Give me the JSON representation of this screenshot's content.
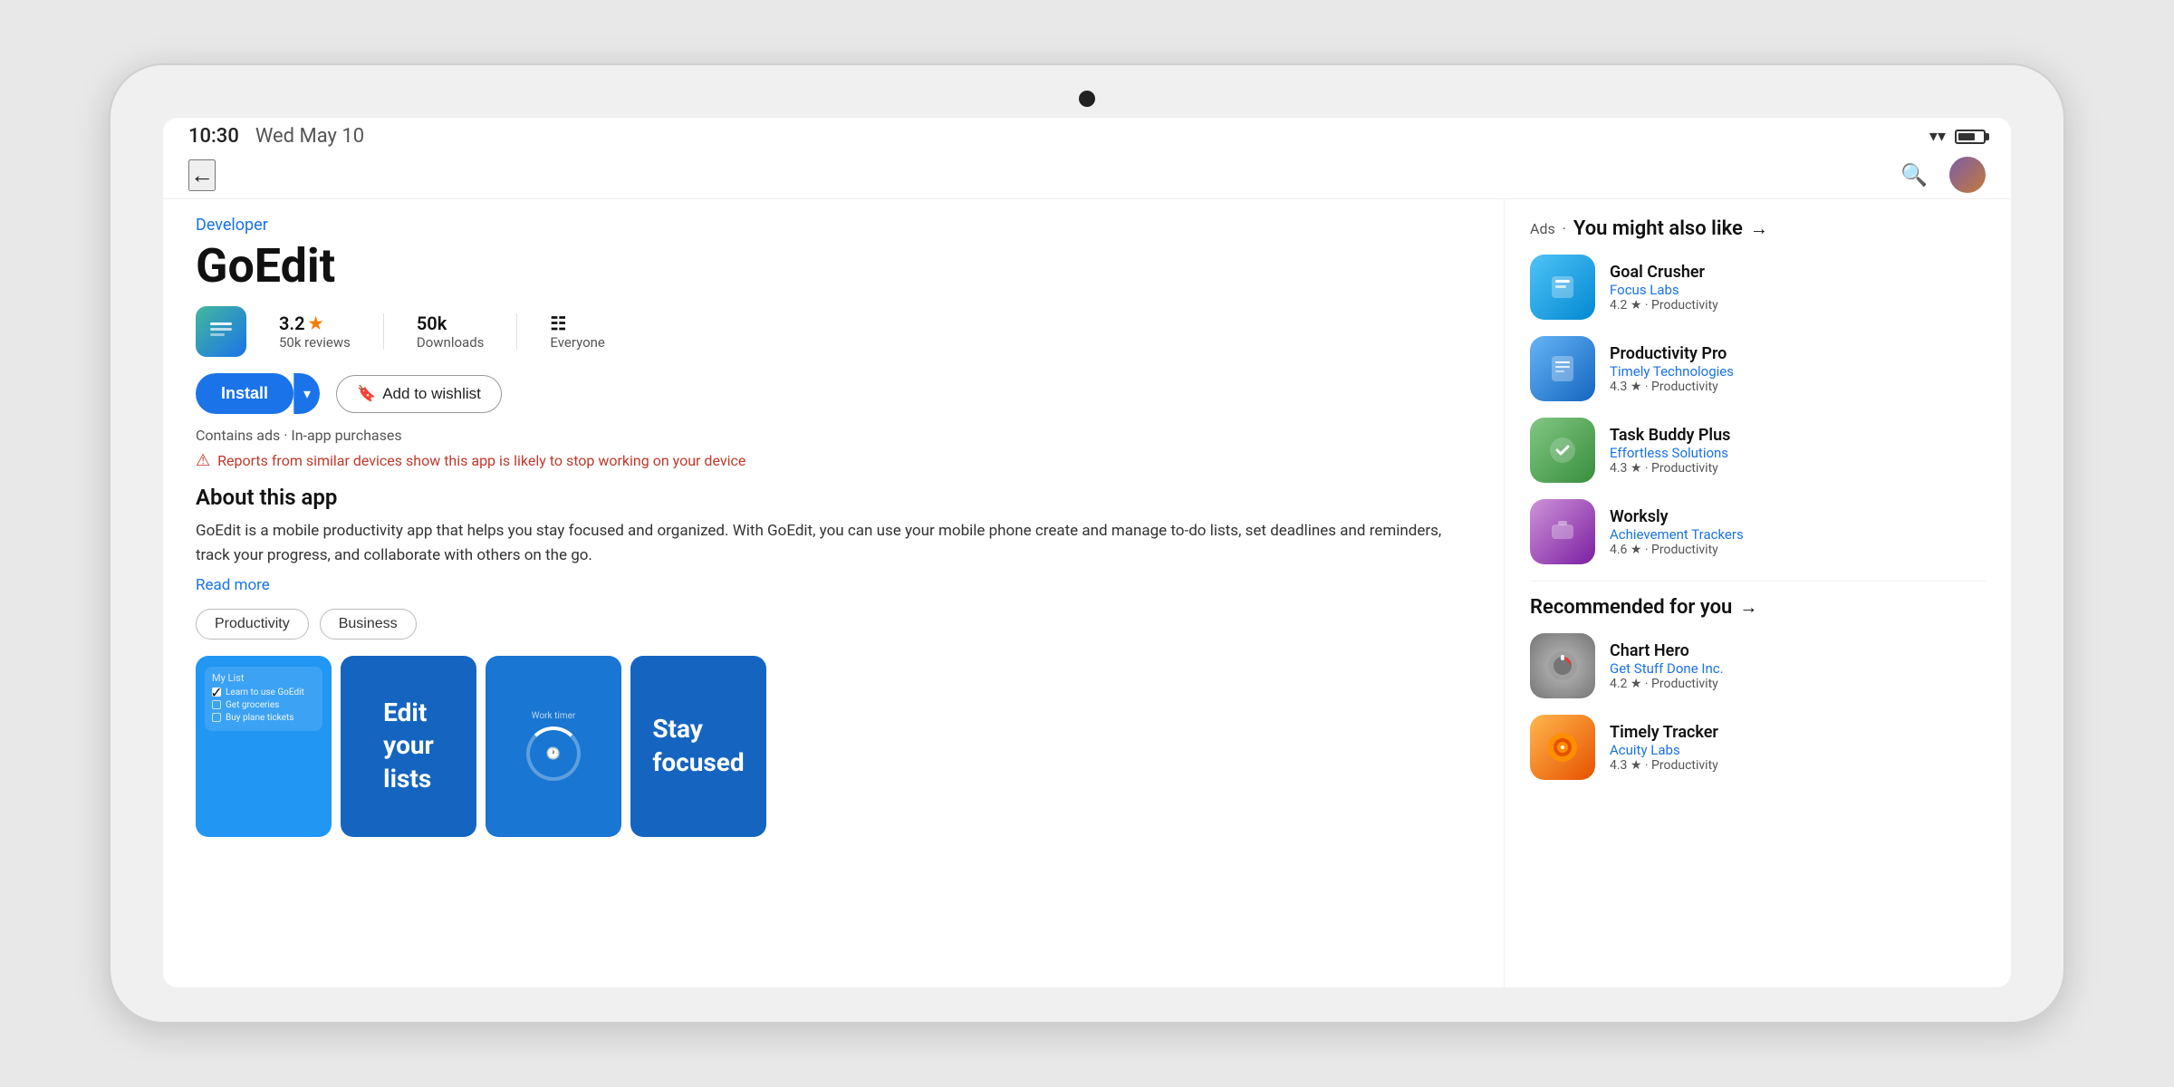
{
  "device": {
    "time": "10:30",
    "date": "Wed May 10"
  },
  "app": {
    "developer": "Developer",
    "title": "GoEdit",
    "rating": "3.2",
    "rating_star": "★",
    "reviews": "50k reviews",
    "downloads": "50k",
    "downloads_label": "Downloads",
    "audience": "Everyone",
    "install_label": "Install",
    "wishlist_label": "Add to wishlist",
    "ads_label": "Contains ads · In-app purchases",
    "warning": "Reports from similar devices show this app is likely to stop working on your device",
    "about_title": "About this app",
    "about_text": "GoEdit is a mobile productivity app that helps you stay focused and organized. With GoEdit, you can use your mobile phone create and manage to-do lists, set deadlines and reminders, track your progress, and collaborate with others on the go.",
    "read_more": "Read more",
    "tags": [
      "Productivity",
      "Business"
    ],
    "screenshot_edit": "Edit\nyour\nlists",
    "screenshot_focus": "Stay\nfocused",
    "list_header": "My List",
    "list_items": [
      {
        "text": "Learn to use GoEdit",
        "checked": true
      },
      {
        "text": "Get groceries",
        "checked": false
      },
      {
        "text": "Buy plane tickets",
        "checked": false
      }
    ]
  },
  "sidebar": {
    "ads_label": "Ads",
    "might_also_like": "You might also like",
    "recommended": "Recommended for you",
    "apps_might_like": [
      {
        "name": "Goal Crusher",
        "developer": "Focus Labs",
        "rating": "4.2",
        "category": "Productivity",
        "icon_type": "goal-crusher"
      },
      {
        "name": "Productivity Pro",
        "developer": "Timely Technologies",
        "rating": "4.3",
        "category": "Productivity",
        "icon_type": "productivity-pro"
      },
      {
        "name": "Task Buddy Plus",
        "developer": "Effortless Solutions",
        "rating": "4.3",
        "category": "Productivity",
        "icon_type": "task-buddy"
      },
      {
        "name": "Worksly",
        "developer": "Achievement Trackers",
        "rating": "4.6",
        "category": "Productivity",
        "icon_type": "worksly"
      }
    ],
    "apps_recommended": [
      {
        "name": "Chart Hero",
        "developer": "Get Stuff Done Inc.",
        "rating": "4.2",
        "category": "Productivity",
        "icon_type": "chart-hero"
      },
      {
        "name": "Timely Tracker",
        "developer": "Acuity Labs",
        "rating": "4.3",
        "category": "Productivity",
        "icon_type": "timely-tracker"
      }
    ]
  }
}
